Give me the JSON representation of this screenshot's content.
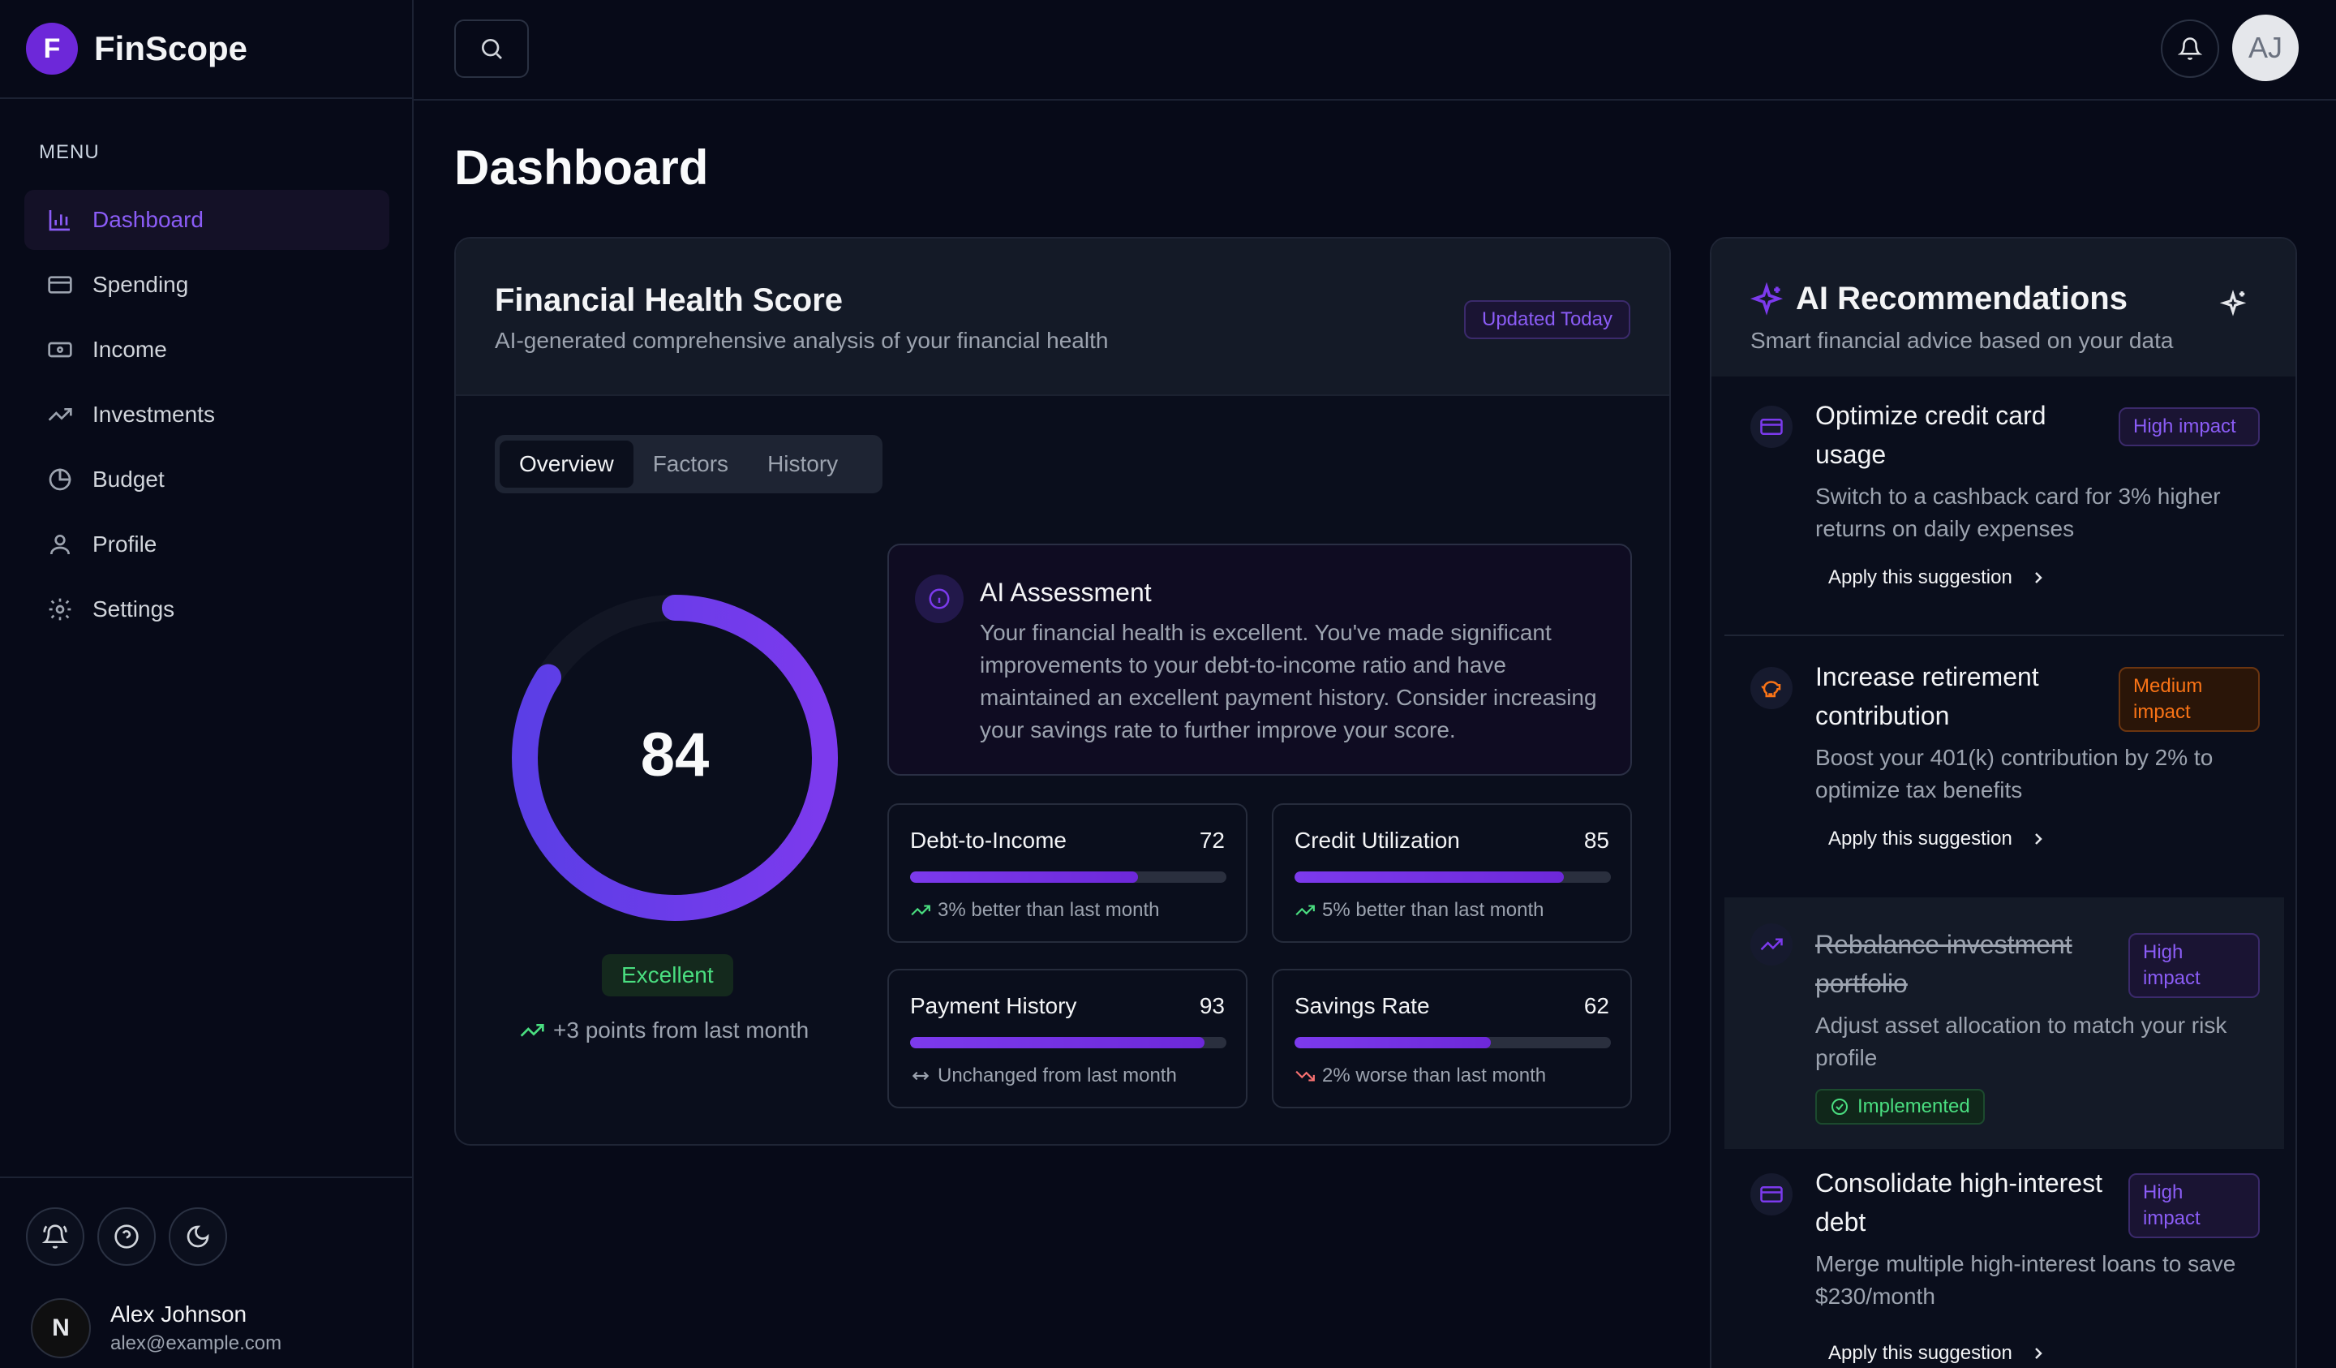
{
  "brand": {
    "logo_letter": "F",
    "name": "FinScope"
  },
  "menu": {
    "heading": "MENU",
    "items": [
      {
        "label": "Dashboard",
        "icon": "bar-chart-icon",
        "active": true
      },
      {
        "label": "Spending",
        "icon": "credit-card-icon"
      },
      {
        "label": "Income",
        "icon": "banknote-icon"
      },
      {
        "label": "Investments",
        "icon": "trending-up-icon"
      },
      {
        "label": "Budget",
        "icon": "pie-chart-icon"
      },
      {
        "label": "Profile",
        "icon": "user-icon"
      },
      {
        "label": "Settings",
        "icon": "gear-icon"
      }
    ]
  },
  "user": {
    "name": "Alex Johnson",
    "email": "alex@example.com",
    "avatar_initial": "N"
  },
  "topbar": {
    "avatar_initials": "AJ"
  },
  "page": {
    "title": "Dashboard"
  },
  "health": {
    "title": "Financial Health Score",
    "subtitle": "AI-generated comprehensive analysis of your financial health",
    "badge": "Updated Today",
    "tabs": [
      "Overview",
      "Factors",
      "History"
    ],
    "active_tab": "Overview",
    "score": "84",
    "score_fraction": 0.84,
    "rating": "Excellent",
    "change": "+3 points from last month",
    "assessment": {
      "title": "AI Assessment",
      "text": "Your financial health is excellent. You've made significant improvements to your debt-to-income ratio and have maintained an excellent payment history. Consider increasing your savings rate to further improve your score."
    },
    "metrics": [
      {
        "name": "Debt-to-Income",
        "value": "72",
        "fraction": 0.72,
        "trend": "3% better than last month",
        "direction": "up"
      },
      {
        "name": "Credit Utilization",
        "value": "85",
        "fraction": 0.85,
        "trend": "5% better than last month",
        "direction": "up"
      },
      {
        "name": "Payment History",
        "value": "93",
        "fraction": 0.93,
        "trend": "Unchanged from last month",
        "direction": "flat"
      },
      {
        "name": "Savings Rate",
        "value": "62",
        "fraction": 0.62,
        "trend": "2% worse than last month",
        "direction": "down"
      }
    ]
  },
  "ai": {
    "title": "AI Recommendations",
    "subtitle": "Smart financial advice based on your data",
    "recommendations": [
      {
        "title": "Optimize credit card usage",
        "impact": "High impact",
        "desc": "Switch to a cashback card for 3% higher returns on daily expenses",
        "action": "Apply this suggestion",
        "icon": "credit-card-icon"
      },
      {
        "title": "Increase retirement contribution",
        "impact": "Medium impact",
        "desc": "Boost your 401(k) contribution by 2% to optimize tax benefits",
        "action": "Apply this suggestion",
        "icon": "piggy-bank-icon"
      },
      {
        "title": "Rebalance investment portfolio",
        "impact": "High impact",
        "desc": "Adjust asset allocation to match your risk profile",
        "status": "Implemented",
        "icon": "trending-up-icon"
      },
      {
        "title": "Consolidate high-interest debt",
        "impact": "High impact",
        "desc": "Merge multiple high-interest loans to save $230/month",
        "action": "Apply this suggestion",
        "icon": "credit-card-icon"
      }
    ]
  },
  "colors": {
    "accent": "#7c3aed",
    "positive": "#4ade80",
    "negative": "#f87171",
    "warning": "#f97316"
  }
}
